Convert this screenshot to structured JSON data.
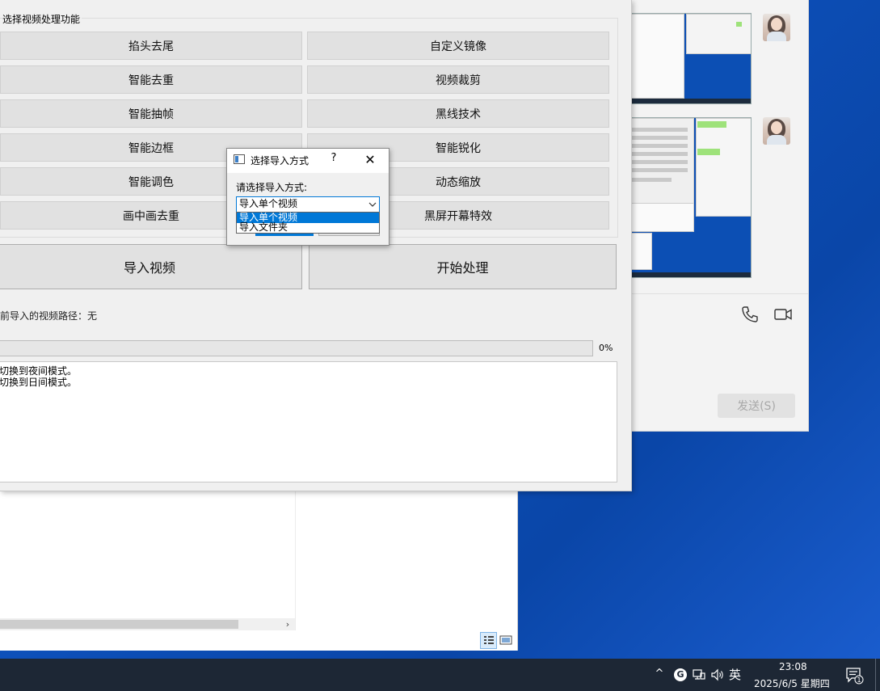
{
  "main_window": {
    "group_title": "选择视频处理功能",
    "functions": [
      [
        "掐头去尾",
        "自定义镜像"
      ],
      [
        "智能去重",
        "视频裁剪"
      ],
      [
        "智能抽帧",
        "黑线技术"
      ],
      [
        "智能边框",
        "智能锐化"
      ],
      [
        "智能调色",
        "动态缩放"
      ],
      [
        "画中画去重",
        "黑屏开幕特效"
      ]
    ],
    "import_button": "导入视频",
    "process_button": "开始处理",
    "path_label": "前导入的视频路径：无",
    "progress": {
      "percent": 0,
      "text": "0%"
    },
    "log_lines": [
      "切换到夜间模式。",
      "切换到日间模式。"
    ]
  },
  "dialog": {
    "title": "选择导入方式",
    "help": "?",
    "close": "✕",
    "prompt": "请选择导入方式:",
    "combo_value": "导入单个视频",
    "options": [
      "导入单个视频",
      "导入文件夹"
    ],
    "selected_index": 0
  },
  "chat_window": {
    "send_button": "发送(S)"
  },
  "explorer": {
    "scroll_right": "›"
  },
  "taskbar": {
    "chevron": "^",
    "ime": "英",
    "time": "23:08",
    "date": "2025/6/5 星期四"
  },
  "colors": {
    "accent": "#0078d7",
    "progress": "#06b025",
    "taskbar": "#1d2735",
    "desktop": "#0d4fb8"
  }
}
